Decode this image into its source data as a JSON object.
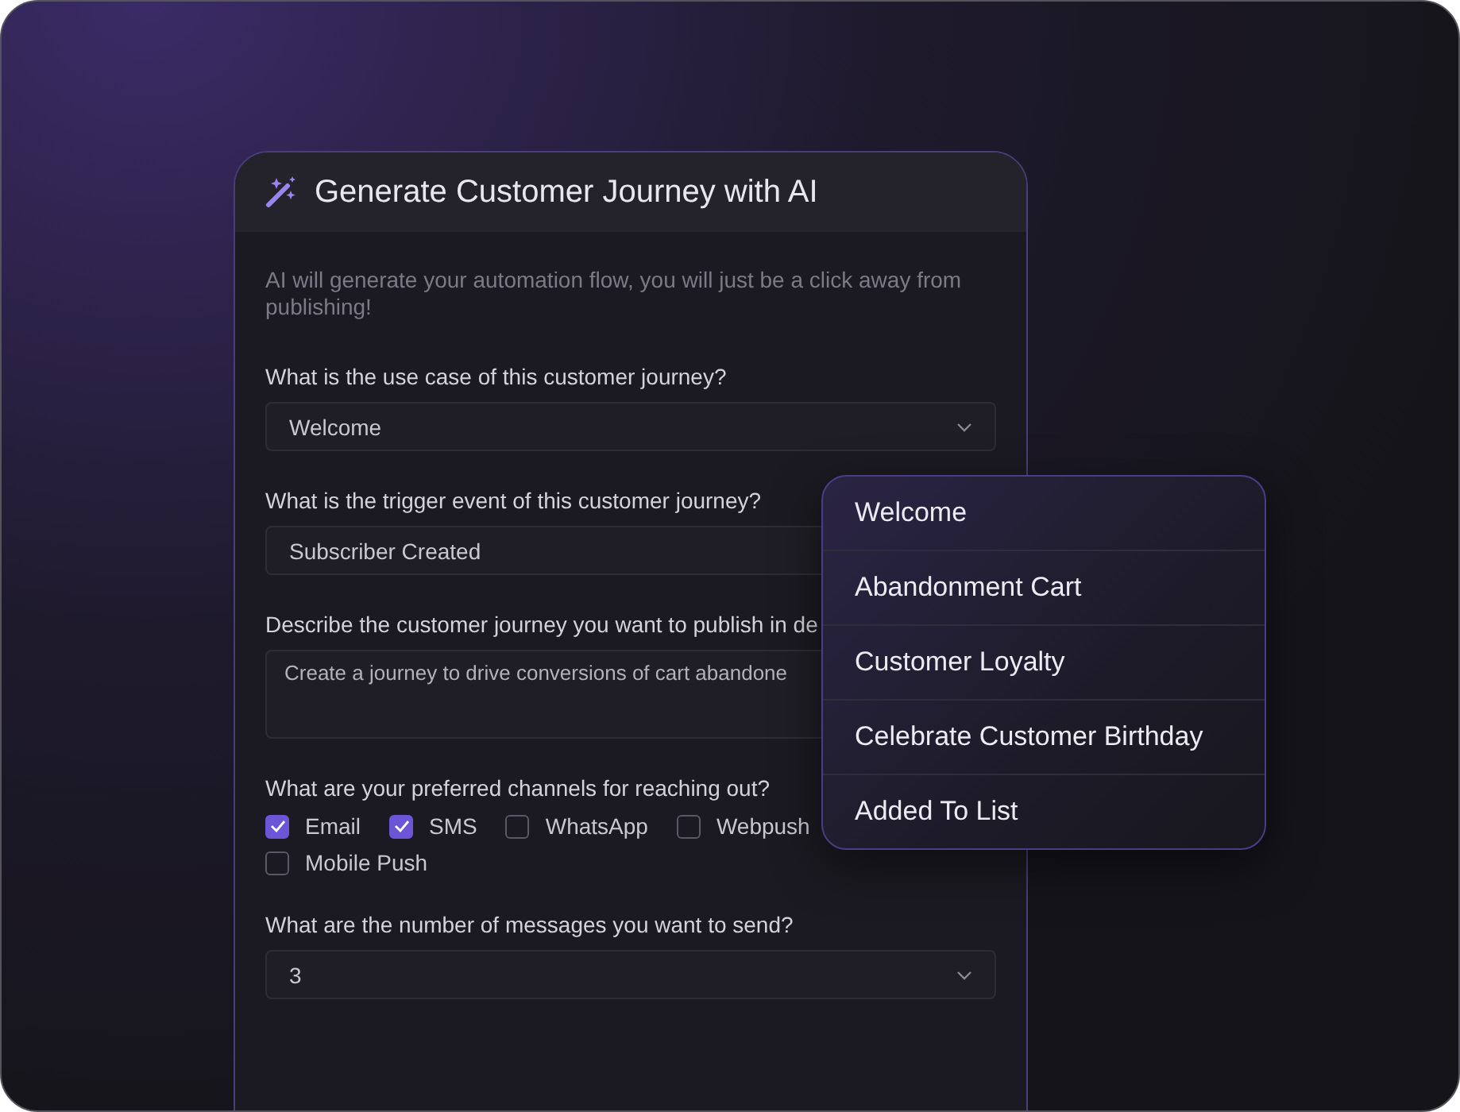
{
  "dialog": {
    "title": "Generate Customer Journey with AI",
    "intro": "AI will generate your automation flow, you will just be a click away from publishing!"
  },
  "fields": [
    {
      "kind": "select",
      "label": "What is the use case of this customer journey?",
      "value": "Welcome"
    },
    {
      "kind": "select",
      "label": "What is the trigger event of this customer journey?",
      "value": "Subscriber Created"
    },
    {
      "kind": "textarea",
      "label": "Describe the customer journey you want to publish in de",
      "value": "Create a journey to drive conversions of cart abandone"
    },
    {
      "kind": "checkboxes",
      "label": "What are your preferred channels for reaching out?",
      "options": [
        {
          "label": "Email",
          "checked": true
        },
        {
          "label": "SMS",
          "checked": true
        },
        {
          "label": "WhatsApp",
          "checked": false
        },
        {
          "label": "Webpush",
          "checked": false
        },
        {
          "label": "Mobile Push",
          "checked": false
        }
      ]
    },
    {
      "kind": "select",
      "label": "What are the number of messages you want to send?",
      "value": "3"
    }
  ],
  "dropdown": {
    "items": [
      "Welcome",
      "Abandonment Cart",
      "Customer Loyalty",
      "Celebrate Customer Birthday",
      "Added To List"
    ]
  }
}
